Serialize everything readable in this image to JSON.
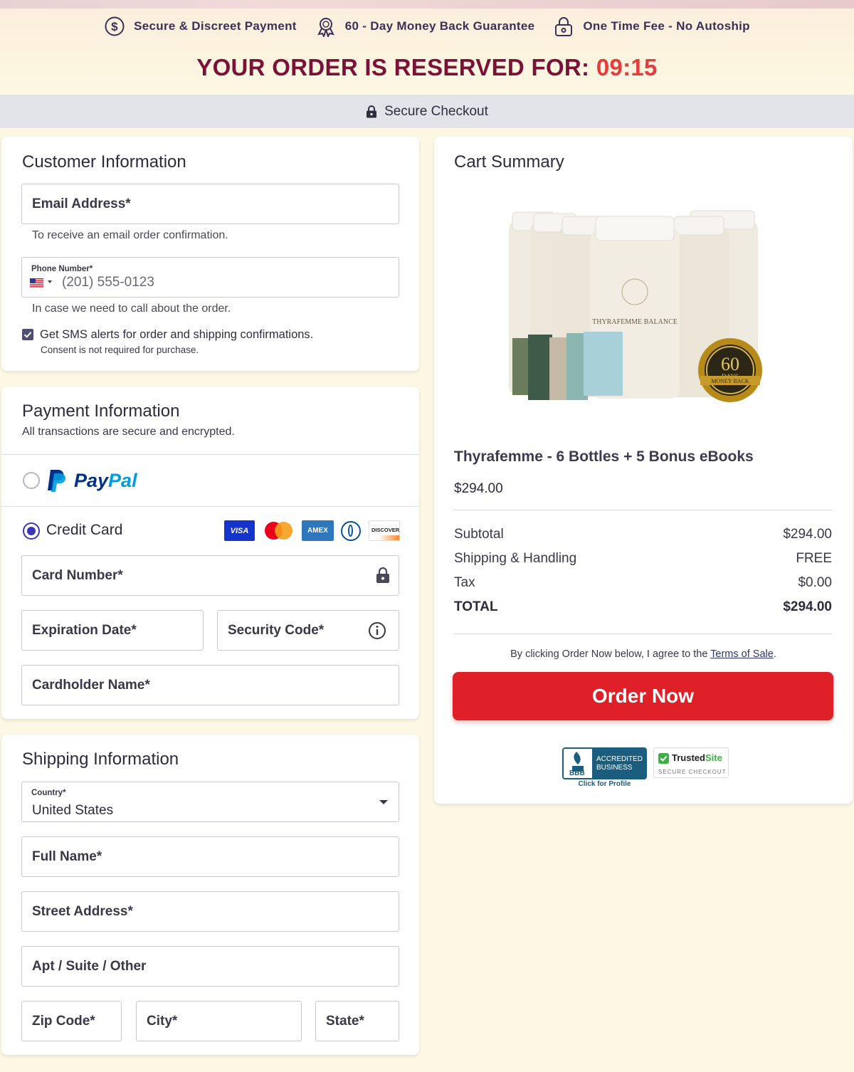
{
  "header": {
    "trust": [
      "Secure & Discreet Payment",
      "60 - Day Money Back Guarantee",
      "One Time Fee - No Autoship"
    ],
    "reserved_text": "YOUR ORDER IS RESERVED FOR: ",
    "timer": "09:15",
    "secure_checkout": "Secure Checkout"
  },
  "customer": {
    "title": "Customer Information",
    "email_label": "Email Address*",
    "email_hint": "To receive an email order confirmation.",
    "phone_label": "Phone Number*",
    "phone_placeholder": "(201) 555-0123",
    "phone_hint": "In case we need to call about the order.",
    "sms_label": "Get SMS alerts for order and shipping confirmations.",
    "sms_checked": true,
    "consent": "Consent is not required for purchase."
  },
  "payment": {
    "title": "Payment Information",
    "subtitle": "All transactions are secure and encrypted.",
    "paypal_label": "PayPal",
    "paypal_selected": false,
    "credit_label": "Credit Card",
    "credit_selected": true,
    "card_logos": [
      "VISA",
      "mastercard",
      "AMEX",
      "diners",
      "DISCOVER"
    ],
    "card_number_label": "Card Number*",
    "expiration_label": "Expiration Date*",
    "security_label": "Security Code*",
    "cardholder_label": "Cardholder Name*"
  },
  "shipping": {
    "title": "Shipping Information",
    "country_label": "Country*",
    "country_value": "United States",
    "fullname_label": "Full Name*",
    "street_label": "Street Address*",
    "apt_label": "Apt / Suite / Other",
    "zip_label": "Zip Code*",
    "city_label": "City*",
    "state_label": "State*"
  },
  "cart": {
    "title": "Cart Summary",
    "product_name": "Thyrafemme - 6 Bottles + 5 Bonus eBooks",
    "product_price": "$294.00",
    "subtotal_label": "Subtotal",
    "subtotal_value": "$294.00",
    "shipping_label": "Shipping & Handling",
    "shipping_value": "FREE",
    "tax_label": "Tax",
    "tax_value": "$0.00",
    "total_label": "TOTAL",
    "total_value": "$294.00",
    "terms_prefix": "By clicking Order Now below, I agree to the ",
    "terms_link": "Terms of Sale",
    "terms_suffix": ".",
    "order_button": "Order Now",
    "bottle_label": "THYRAFEMME BALANCE",
    "badge_days": "60",
    "badge_days_word": "DAYS",
    "badge_money_back": "MONEY BACK",
    "bbb_accredited": "ACCREDITED",
    "bbb_business": "BUSINESS",
    "bbb_logo": "BBB",
    "bbb_click": "Click for Profile",
    "trusted_a": "Trusted",
    "trusted_b": "Site",
    "trusted_sub": "SECURE CHECKOUT"
  },
  "colors": {
    "accent_red": "#e02029",
    "timer_red": "#e53d3d",
    "maroon": "#7a1238",
    "radio_blue": "#3b36b8",
    "paypal_dark": "#003087",
    "paypal_light": "#009cde"
  }
}
